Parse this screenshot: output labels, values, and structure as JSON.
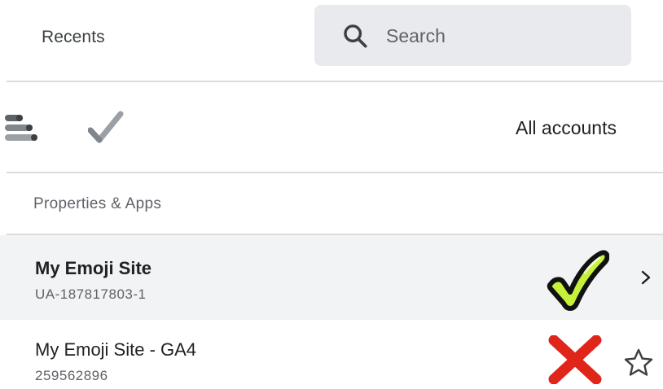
{
  "header": {
    "tab_label": "Recents",
    "search": {
      "placeholder": "Search",
      "value": ""
    }
  },
  "filter_bar": {
    "scope_label": "All accounts"
  },
  "section": {
    "heading": "Properties & Apps"
  },
  "properties": [
    {
      "name": "My Emoji Site",
      "id": "UA-187817803-1",
      "status_icon": "check-mark-emoji",
      "selected": true
    },
    {
      "name": "My Emoji Site - GA4",
      "id": "259562896",
      "status_icon": "cross-mark-emoji",
      "selected": false
    }
  ],
  "colors": {
    "search_bg": "#e8eaed",
    "selected_row_bg": "#f1f3f4",
    "divider": "#dadce0",
    "check_green": "#c6f03b",
    "cross_red": "#e0251b"
  }
}
